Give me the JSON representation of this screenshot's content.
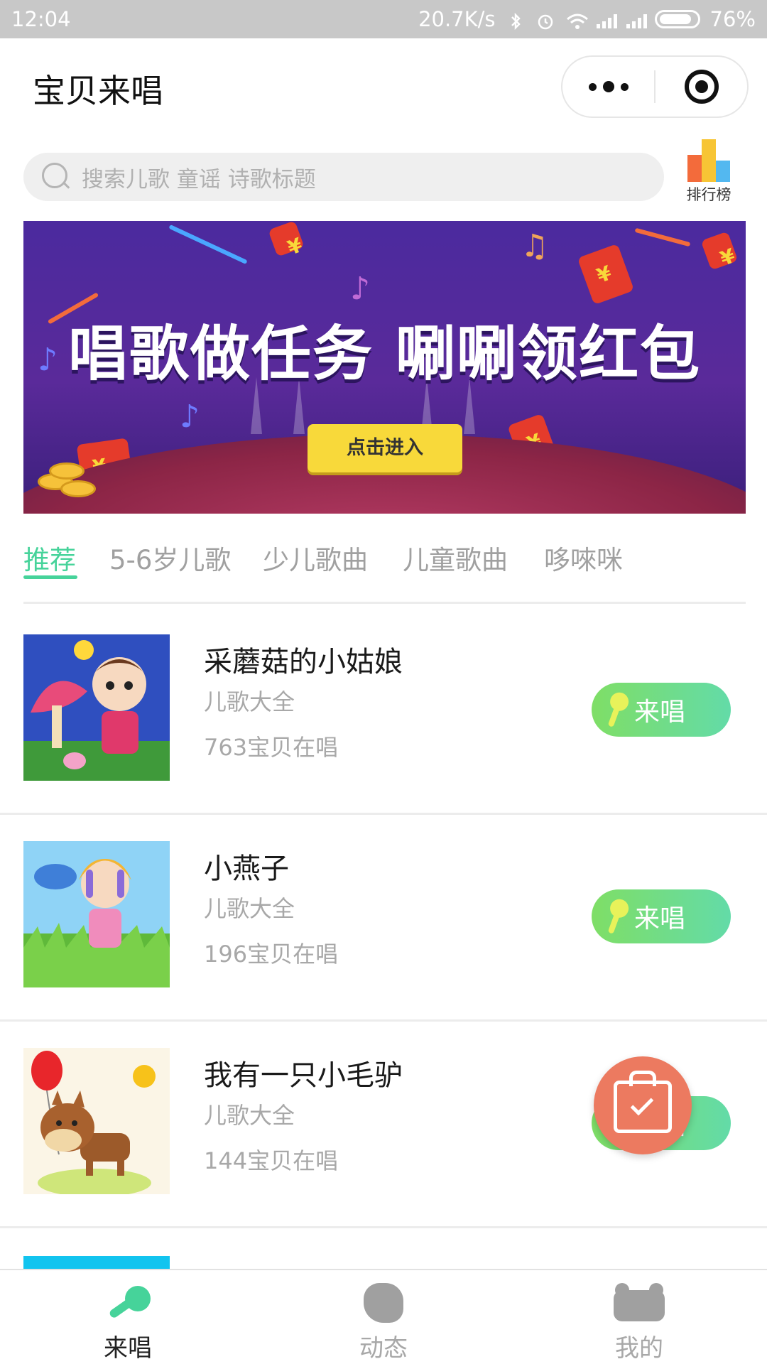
{
  "status_bar": {
    "time": "12:04",
    "network_speed": "20.7K/s",
    "battery": "76%",
    "icons": [
      "bluetooth-icon",
      "alarm-icon",
      "wifi-icon",
      "signal-icon",
      "signal-icon",
      "battery-icon"
    ]
  },
  "header": {
    "title": "宝贝来唱",
    "menu_icon": "more-dots-icon",
    "close_icon": "close-target-icon"
  },
  "search": {
    "placeholder": "搜索儿歌 童谣 诗歌标题"
  },
  "ranking": {
    "label": "排行榜",
    "icon": "ranking-bars-icon"
  },
  "banner": {
    "headline": "唱歌做任务 唰唰领红包",
    "cta": "点击进入"
  },
  "tabs": [
    {
      "label": "推荐",
      "active": true
    },
    {
      "label": "5-6岁儿歌",
      "active": false
    },
    {
      "label": "少儿歌曲",
      "active": false
    },
    {
      "label": "儿童歌曲",
      "active": false
    },
    {
      "label": "哆唻咪",
      "active": false
    }
  ],
  "songs": [
    {
      "title": "采蘑菇的小姑娘",
      "category": "儿歌大全",
      "count": "763宝贝在唱",
      "action": "来唱"
    },
    {
      "title": "小燕子",
      "category": "儿歌大全",
      "count": "196宝贝在唱",
      "action": "来唱"
    },
    {
      "title": "我有一只小毛驴",
      "category": "儿歌大全",
      "count": "144宝贝在唱",
      "action": "来唱"
    }
  ],
  "floating_button": {
    "icon": "shopping-bag-check-icon"
  },
  "bottom_nav": [
    {
      "label": "来唱",
      "icon": "microphone-icon",
      "active": true
    },
    {
      "label": "动态",
      "icon": "flower-icon",
      "active": false
    },
    {
      "label": "我的",
      "icon": "bear-icon",
      "active": false
    }
  ],
  "colors": {
    "accent": "#46d39a",
    "button_gradient_start": "#7fde66",
    "button_gradient_end": "#63dba8",
    "floating_button": "#ec7a60",
    "status_bar": "#c8c8c8"
  }
}
